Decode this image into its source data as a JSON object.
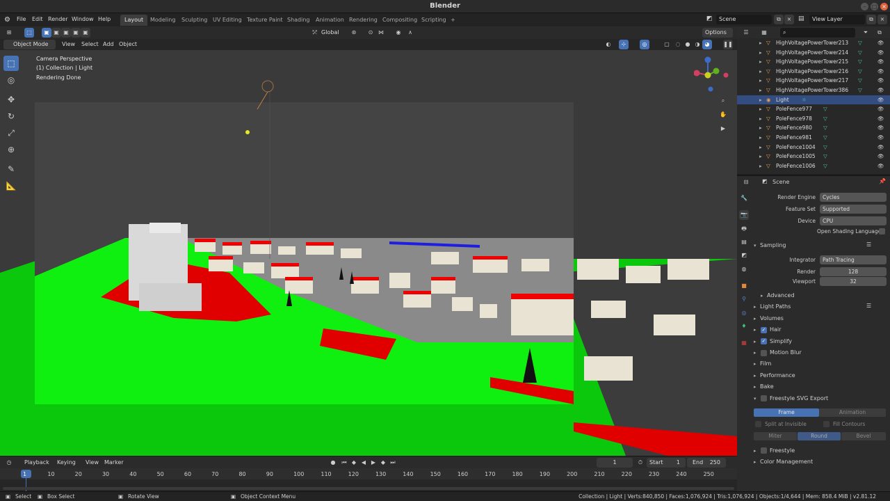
{
  "window": {
    "title": "Blender"
  },
  "menubar": {
    "menus": [
      "File",
      "Edit",
      "Render",
      "Window",
      "Help"
    ],
    "workspaces": [
      "Layout",
      "Modeling",
      "Sculpting",
      "UV Editing",
      "Texture Paint",
      "Shading",
      "Animation",
      "Rendering",
      "Compositing",
      "Scripting"
    ],
    "add_tab": "+",
    "scene": "Scene",
    "view_layer": "View Layer"
  },
  "viewport_header": {
    "orientation": "Global",
    "options": "Options"
  },
  "viewport_subheader": {
    "mode": "Object Mode",
    "menus": [
      "View",
      "Select",
      "Add",
      "Object"
    ]
  },
  "viewport": {
    "camera_label": "Camera Perspective",
    "collection_label": "(1) Collection | Light",
    "render_status": "Rendering Done"
  },
  "outliner": {
    "items": [
      {
        "name": "HighVoltagePowerTower213",
        "type": "mesh",
        "selected": false
      },
      {
        "name": "HighVoltagePowerTower214",
        "type": "mesh",
        "selected": false
      },
      {
        "name": "HighVoltagePowerTower215",
        "type": "mesh",
        "selected": false
      },
      {
        "name": "HighVoltagePowerTower216",
        "type": "mesh",
        "selected": false
      },
      {
        "name": "HighVoltagePowerTower217",
        "type": "mesh",
        "selected": false
      },
      {
        "name": "HighVoltagePowerTower386",
        "type": "mesh",
        "selected": false
      },
      {
        "name": "Light",
        "type": "light",
        "selected": true
      },
      {
        "name": "PoleFence977",
        "type": "mesh",
        "selected": false
      },
      {
        "name": "PoleFence978",
        "type": "mesh",
        "selected": false
      },
      {
        "name": "PoleFence980",
        "type": "mesh",
        "selected": false
      },
      {
        "name": "PoleFence981",
        "type": "mesh",
        "selected": false
      },
      {
        "name": "PoleFence1004",
        "type": "mesh",
        "selected": false
      },
      {
        "name": "PoleFence1005",
        "type": "mesh",
        "selected": false
      },
      {
        "name": "PoleFence1006",
        "type": "mesh",
        "selected": false
      }
    ]
  },
  "properties": {
    "context": "Scene",
    "render_engine_label": "Render Engine",
    "render_engine": "Cycles",
    "feature_set_label": "Feature Set",
    "feature_set": "Supported",
    "device_label": "Device",
    "device": "CPU",
    "osl_label": "Open Shading Language",
    "sampling": "Sampling",
    "integrator_label": "Integrator",
    "integrator": "Path Tracing",
    "render_label": "Render",
    "render_samples": "128",
    "viewport_label": "Viewport",
    "viewport_samples": "32",
    "advanced": "Advanced",
    "light_paths": "Light Paths",
    "volumes": "Volumes",
    "hair": "Hair",
    "simplify": "Simplify",
    "motion_blur": "Motion Blur",
    "film": "Film",
    "performance": "Performance",
    "bake": "Bake",
    "freestyle_svg": "Freestyle SVG Export",
    "frame_btn": "Frame",
    "animation_btn": "Animation",
    "split_invisible": "Split at Invisible",
    "fill_contours": "Fill Contours",
    "miter": "Miter",
    "round": "Round",
    "bevel": "Bevel",
    "freestyle": "Freestyle",
    "color_management": "Color Management"
  },
  "timeline": {
    "menus": [
      "Playback",
      "Keying",
      "View",
      "Marker"
    ],
    "current_frame": "1",
    "start_label": "Start",
    "start": "1",
    "end_label": "End",
    "end": "250",
    "ruler": [
      "1",
      "10",
      "20",
      "30",
      "40",
      "50",
      "60",
      "70",
      "80",
      "90",
      "100",
      "110",
      "120",
      "130",
      "140",
      "150",
      "160",
      "170",
      "180",
      "190",
      "200",
      "210",
      "220",
      "230",
      "240",
      "250"
    ]
  },
  "statusbar": {
    "select": "Select",
    "box_select": "Box Select",
    "rotate_view": "Rotate View",
    "context_menu": "Object Context Menu",
    "stats": "Collection | Light | Verts:840,850 | Faces:1,076,924 | Tris:1,076,924 | Objects:1/4,644 | Mem: 858.4 MiB | v2.81.12"
  },
  "colors": {
    "accent": "#4772b3",
    "ground": "#0cf00c",
    "roofs": "#f00000",
    "header": "#2b2b2b"
  }
}
